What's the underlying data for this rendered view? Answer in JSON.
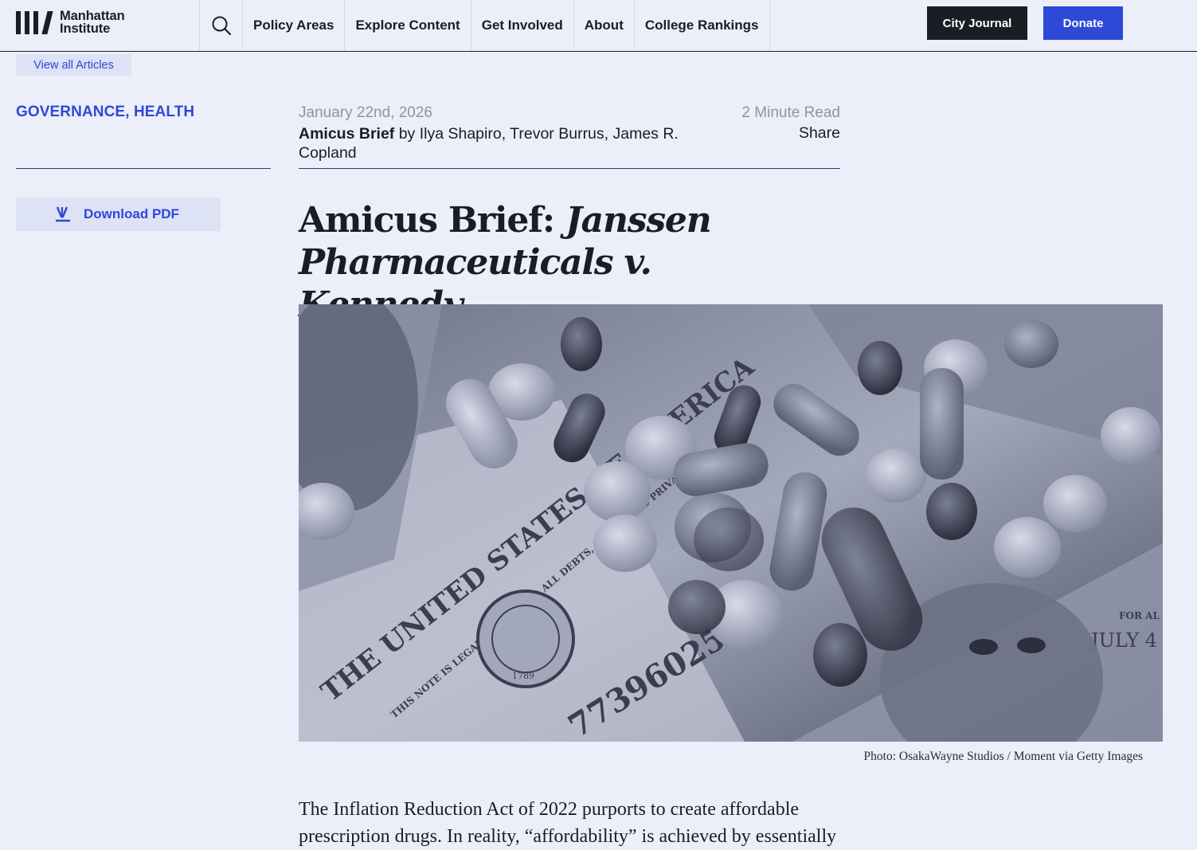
{
  "header": {
    "logo_line1": "Manhattan",
    "logo_line2": "Institute",
    "nav": [
      "Policy Areas",
      "Explore Content",
      "Get Involved",
      "About",
      "College Rankings"
    ],
    "city_journal": "City Journal",
    "donate": "Donate"
  },
  "view_all": "View all Articles",
  "topics": {
    "first": "GOVERNANCE",
    "sep": ", ",
    "second": "HEALTH"
  },
  "download_pdf": "Download PDF",
  "meta": {
    "date": "January 22nd, 2026",
    "read_time": "2 Minute Read",
    "type": "Amicus Brief",
    "byline": " by Ilya Shapiro, Trevor Burrus, James R. Copland",
    "share": "Share"
  },
  "title": {
    "plain": "Amicus Brief: ",
    "italic": "Janssen Pharmaceuticals v. Kennedy"
  },
  "hero_image": {
    "visible_text": [
      "77396025 E",
      "JULY 4",
      "FOR AL",
      "THIS NOTE IS LEGAL TENDER FOR ALL DEBTS, PUBLIC AND PRIVATE",
      "THE UNITED STATES OF AMERICA",
      "1789"
    ]
  },
  "caption": "Photo: OsakaWayne Studios / Moment via Getty Images",
  "body": "The Inflation Reduction Act of 2022 purports to create affordable prescription drugs. In reality, “affordability” is achieved by essentially",
  "colors": {
    "background": "#eceff9",
    "accent": "#2e48d8",
    "dark": "#1b1d24"
  }
}
